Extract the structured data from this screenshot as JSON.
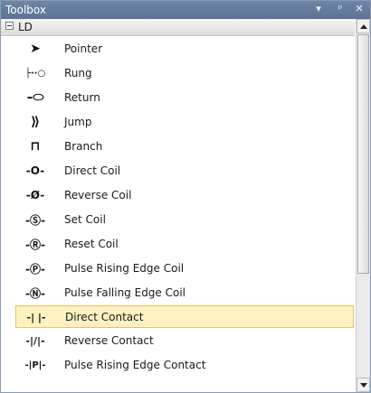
{
  "window": {
    "title": "Toolbox",
    "buttons": {
      "dropdown_glyph": "▾",
      "pin_glyph": "ᵖ",
      "close_glyph": "✕"
    }
  },
  "group": {
    "label": "LD",
    "expanded": true
  },
  "items": [
    {
      "label": "Pointer",
      "icon": "pointer-icon",
      "glyph": "➤"
    },
    {
      "label": "Rung",
      "icon": "rung-icon",
      "glyph": "├··○"
    },
    {
      "label": "Return",
      "icon": "return-icon",
      "glyph": "–⬭"
    },
    {
      "label": "Jump",
      "icon": "jump-icon",
      "glyph": "⟫"
    },
    {
      "label": "Branch",
      "icon": "branch-icon",
      "glyph": "⊓"
    },
    {
      "label": "Direct Coil",
      "icon": "direct-coil-icon",
      "glyph": "-O-"
    },
    {
      "label": "Reverse Coil",
      "icon": "reverse-coil-icon",
      "glyph": "-Ø-"
    },
    {
      "label": "Set Coil",
      "icon": "set-coil-icon",
      "glyph": "-Ⓢ-"
    },
    {
      "label": "Reset Coil",
      "icon": "reset-coil-icon",
      "glyph": "-Ⓡ-"
    },
    {
      "label": "Pulse Rising Edge Coil",
      "icon": "pulse-rising-edge-coil-icon",
      "glyph": "-Ⓟ-"
    },
    {
      "label": "Pulse Falling Edge Coil",
      "icon": "pulse-falling-edge-coil-icon",
      "glyph": "-Ⓝ-"
    },
    {
      "label": "Direct Contact",
      "icon": "direct-contact-icon",
      "glyph": "-| |-",
      "selected": true
    },
    {
      "label": "Reverse Contact",
      "icon": "reverse-contact-icon",
      "glyph": "-|/|-"
    },
    {
      "label": "Pulse Rising Edge Contact",
      "icon": "pulse-rising-edge-contact-icon",
      "glyph": "-|P|-"
    }
  ],
  "colors": {
    "titlebar": "#5b7394",
    "selected_bg": "#fdf1c1",
    "selected_border": "#e5c365"
  }
}
